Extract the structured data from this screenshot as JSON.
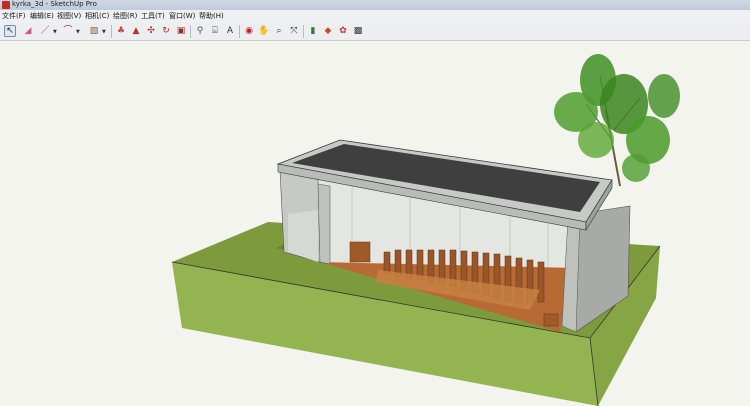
{
  "window": {
    "title": "kyrka_3d - SketchUp Pro"
  },
  "menu": {
    "items": [
      "文件(F)",
      "编辑(E)",
      "视图(V)",
      "相机(C)",
      "绘图(R)",
      "工具(T)",
      "窗口(W)",
      "帮助(H)"
    ]
  },
  "toolbar": {
    "tools": [
      {
        "name": "select-tool",
        "icon": "arrow-cursor-icon",
        "glyph": "↖",
        "color": "#222222"
      },
      {
        "name": "eraser-tool",
        "icon": "eraser-icon",
        "glyph": "◢",
        "color": "#d45a7a"
      },
      {
        "name": "line-tool",
        "icon": "pencil-icon",
        "glyph": "／",
        "color": "#b02020"
      },
      {
        "name": "arc-tool",
        "icon": "arc-icon",
        "glyph": "⌒",
        "color": "#b02020"
      },
      {
        "name": "rectangle-tool",
        "icon": "rectangle-icon",
        "glyph": "▧",
        "color": "#8a5a3a"
      },
      {
        "name": "paint-bucket-tool",
        "icon": "paint-bucket-icon",
        "glyph": "♣",
        "color": "#c04848"
      },
      {
        "name": "push-pull-tool",
        "icon": "push-pull-icon",
        "glyph": "▲",
        "color": "#c03030"
      },
      {
        "name": "move-tool",
        "icon": "move-icon",
        "glyph": "✣",
        "color": "#c02020"
      },
      {
        "name": "rotate-tool",
        "icon": "rotate-icon",
        "glyph": "↻",
        "color": "#c02020"
      },
      {
        "name": "offset-tool",
        "icon": "offset-icon",
        "glyph": "▣",
        "color": "#a02828"
      },
      {
        "name": "tape-measure-tool",
        "icon": "tape-measure-icon",
        "glyph": "⚲",
        "color": "#555555"
      },
      {
        "name": "dimension-tool",
        "icon": "dimension-icon",
        "glyph": "⌸",
        "color": "#444444"
      },
      {
        "name": "text-tool",
        "icon": "text-icon",
        "glyph": "A",
        "color": "#333333"
      },
      {
        "name": "orbit-tool",
        "icon": "orbit-icon",
        "glyph": "◉",
        "color": "#c02020"
      },
      {
        "name": "pan-tool",
        "icon": "hand-icon",
        "glyph": "✋",
        "color": "#444444"
      },
      {
        "name": "zoom-tool",
        "icon": "magnifier-icon",
        "glyph": "⌕",
        "color": "#333333"
      },
      {
        "name": "zoom-extents-tool",
        "icon": "zoom-extents-icon",
        "glyph": "⤧",
        "color": "#333333"
      },
      {
        "name": "components-tool",
        "icon": "book-icon",
        "glyph": "▮",
        "color": "#2e7d32"
      },
      {
        "name": "materials-tool",
        "icon": "paint-palette-icon",
        "glyph": "◆",
        "color": "#c05020"
      },
      {
        "name": "warehouse-tool",
        "icon": "warehouse-icon",
        "glyph": "✿",
        "color": "#c03030"
      },
      {
        "name": "share-model-tool",
        "icon": "share-icon",
        "glyph": "▩",
        "color": "#333333"
      }
    ]
  },
  "colors": {
    "roof": "#3f3f3f",
    "concrete": "#c7c9c6",
    "floor": "#b86a34",
    "grass": "#7d9a3c",
    "soil": "#8fb04f",
    "tree_leaf": "#3f8f25"
  }
}
